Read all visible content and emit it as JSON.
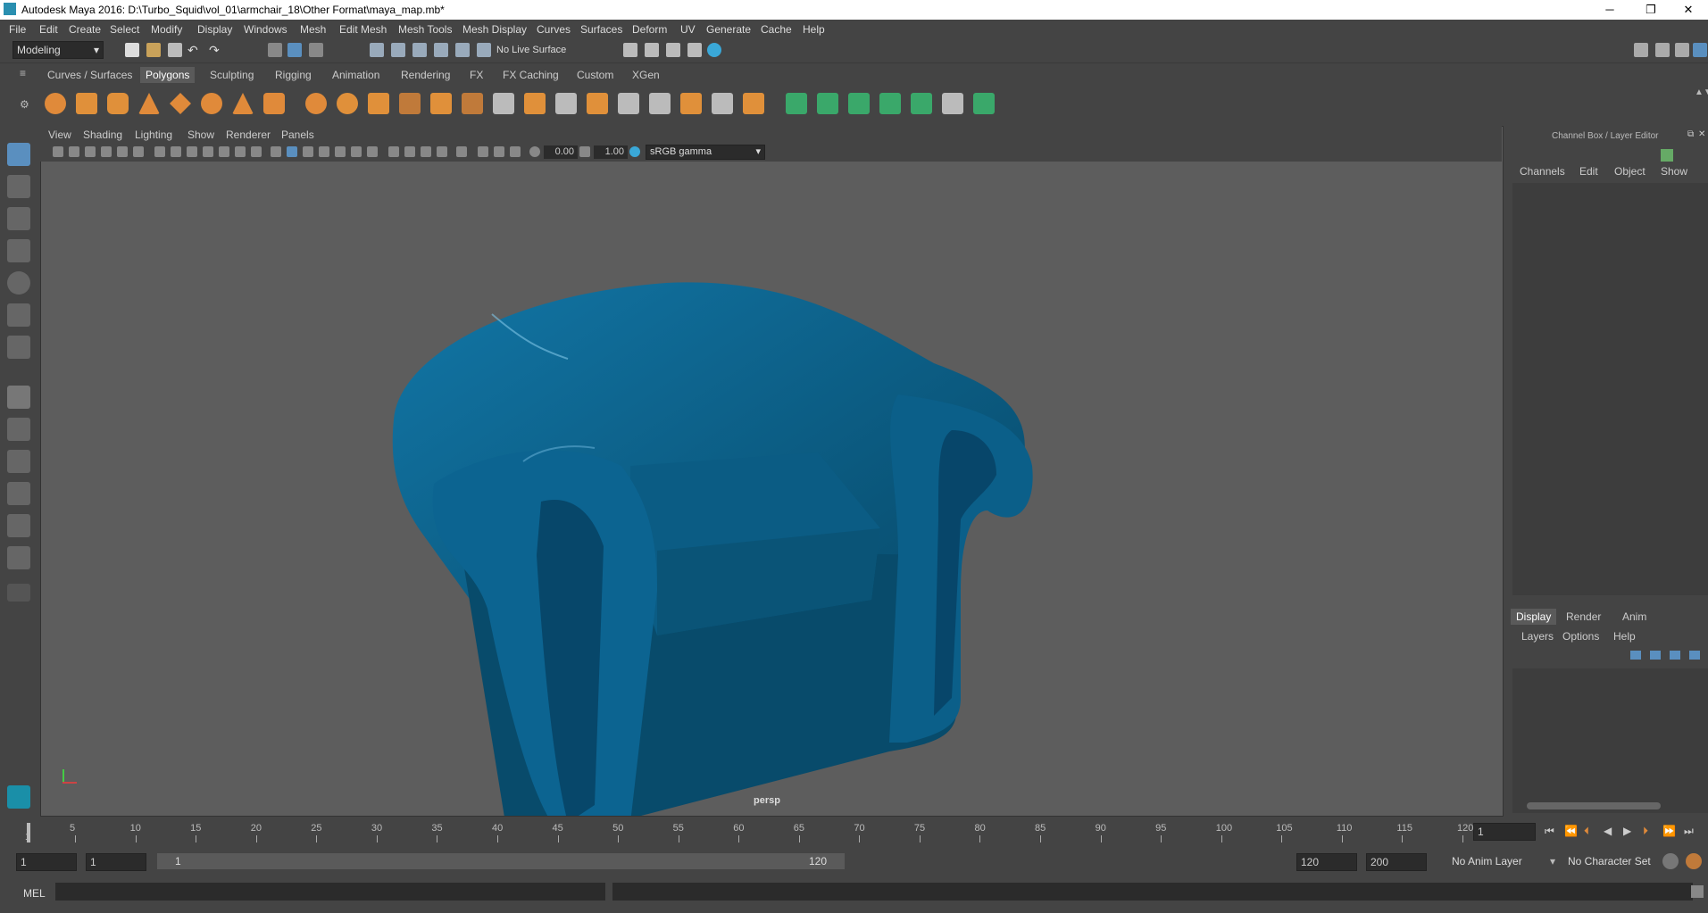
{
  "window": {
    "title": "Autodesk Maya 2016: D:\\Turbo_Squid\\vol_01\\armchair_18\\Other Format\\maya_map.mb*",
    "minimize": "─",
    "maximize": "❐",
    "close": "✕"
  },
  "menu": [
    "File",
    "Edit",
    "Create",
    "Select",
    "Modify",
    "Display",
    "Windows",
    "Mesh",
    "Edit Mesh",
    "Mesh Tools",
    "Mesh Display",
    "Curves",
    "Surfaces",
    "Deform",
    "UV",
    "Generate",
    "Cache",
    "Help"
  ],
  "status": {
    "mode": "Modeling",
    "live_surface": "No Live Surface"
  },
  "shelf_tabs": [
    "Curves / Surfaces",
    "Polygons",
    "Sculpting",
    "Rigging",
    "Animation",
    "Rendering",
    "FX",
    "FX Caching",
    "Custom",
    "XGen"
  ],
  "shelf_active": "Polygons",
  "viewport": {
    "menus": [
      "View",
      "Shading",
      "Lighting",
      "Show",
      "Renderer",
      "Panels"
    ],
    "exposure": "0.00",
    "gamma": "1.00",
    "color_space": "sRGB gamma",
    "camera_label": "persp"
  },
  "channel_box": {
    "title": "Channel Box / Layer Editor",
    "menus": [
      "Channels",
      "Edit",
      "Object",
      "Show"
    ],
    "layer_tabs": [
      "Display",
      "Render",
      "Anim"
    ],
    "layer_active": "Display",
    "layer_menus": [
      "Layers",
      "Options",
      "Help"
    ]
  },
  "timeline": {
    "ticks": [
      "5",
      "10",
      "15",
      "20",
      "25",
      "30",
      "35",
      "40",
      "45",
      "50",
      "55",
      "60",
      "65",
      "70",
      "75",
      "80",
      "85",
      "90",
      "95",
      "100",
      "105",
      "110",
      "115",
      "120"
    ],
    "start_tick": "1",
    "current_frame": "1"
  },
  "range": {
    "start": "1",
    "playback_start": "1",
    "slider_start": "1",
    "slider_end": "120",
    "playback_end": "120",
    "end": "200",
    "anim_layer": "No Anim Layer",
    "character_set": "No Character Set"
  },
  "command": {
    "label": "MEL"
  },
  "colors": {
    "chair": "#0a5a82",
    "viewport_bg": "#5d5d5d",
    "panel_bg": "#444444"
  }
}
